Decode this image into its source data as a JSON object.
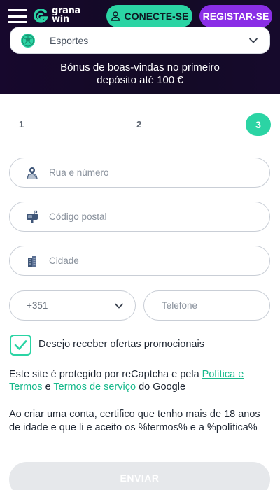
{
  "header": {
    "brand_line1": "grana",
    "brand_line2": "win",
    "login_label": "CONECTE-SE",
    "register_label": "REGISTAR-SE"
  },
  "sport_select": {
    "value": "Esportes"
  },
  "bonus": {
    "line1": "Bónus de boas-vindas no primeiro",
    "line2": "depósito até 100 €"
  },
  "steps": {
    "items": [
      "1",
      "2",
      "3"
    ],
    "current": "3"
  },
  "form": {
    "street_placeholder": "Rua e número",
    "postal_placeholder": "Código postal",
    "city_placeholder": "Cidade",
    "phone_code": "+351",
    "phone_placeholder": "Telefone",
    "promo_label": "Desejo receber ofertas promocionais",
    "promo_checked": true,
    "submit_label": "ENVIAR"
  },
  "legal": {
    "prefix": "Este site é protegido por reCaptcha e pela ",
    "policy_link": "Política e Termos",
    "middle": " e ",
    "terms_link": "Termos de serviço",
    "suffix": " do Google",
    "age_text": "Ao criar uma conta, certifico que tenho mais de 18 anos de idade e que li e aceito os %termos% e a %política%"
  },
  "colors": {
    "accent": "#2bd4a4",
    "purple": "#8a2ee6",
    "header_bg": "#160a2c"
  }
}
